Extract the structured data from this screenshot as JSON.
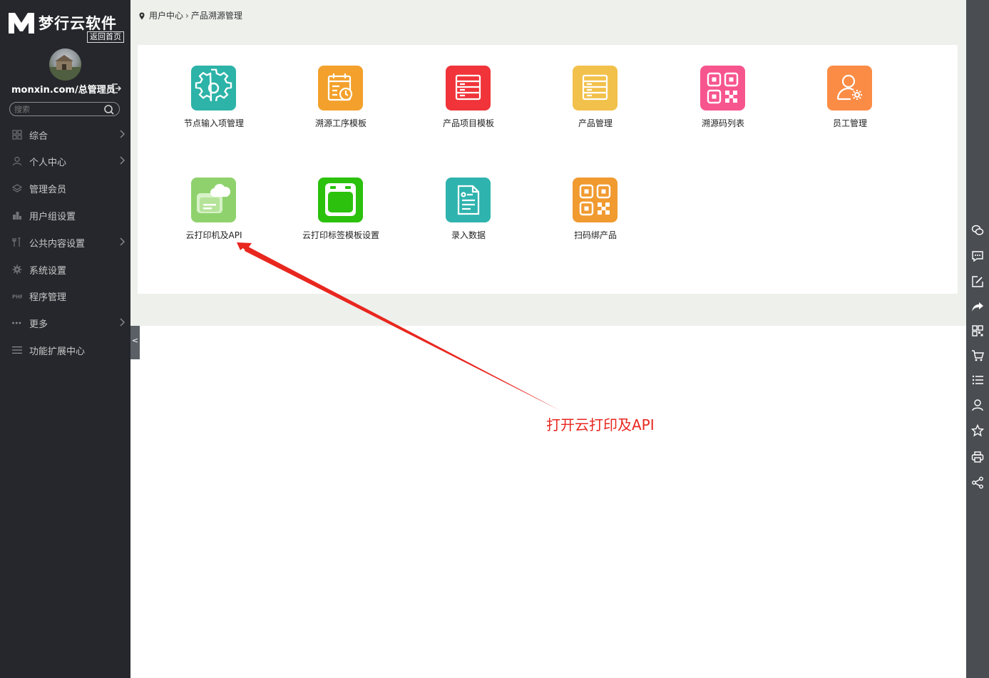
{
  "brand": {
    "name": "梦行云软件",
    "home_link": "返回首页"
  },
  "user": {
    "label": "monxin.com/总管理员"
  },
  "search": {
    "placeholder": "搜索"
  },
  "sidebar": {
    "items": [
      {
        "label": "综合",
        "icon": "grid-icon",
        "has_arrow": true
      },
      {
        "label": "个人中心",
        "icon": "user-icon",
        "has_arrow": true
      },
      {
        "label": "管理会员",
        "icon": "layers-icon",
        "has_arrow": false
      },
      {
        "label": "用户组设置",
        "icon": "buildings-icon",
        "has_arrow": false
      },
      {
        "label": "公共内容设置",
        "icon": "tools-icon",
        "has_arrow": true
      },
      {
        "label": "系统设置",
        "icon": "gear-icon",
        "has_arrow": false
      },
      {
        "label": "程序管理",
        "icon": "php-icon",
        "has_arrow": false
      },
      {
        "label": "更多",
        "icon": "dots-icon",
        "has_arrow": true
      },
      {
        "label": "功能扩展中心",
        "icon": "menu-icon",
        "has_arrow": false
      }
    ],
    "collapse_glyph": "<"
  },
  "breadcrumb": {
    "items": [
      "用户中心",
      "产品溯源管理"
    ],
    "separator": "›"
  },
  "tiles": [
    {
      "label": "节点输入项管理",
      "icon": "gear-icon",
      "color": "#2db3a8"
    },
    {
      "label": "溯源工序模板",
      "icon": "calendar-clock-icon",
      "color": "#f3a12c"
    },
    {
      "label": "产品项目模板",
      "icon": "list-icon",
      "color": "#f0343a"
    },
    {
      "label": "产品管理",
      "icon": "list-icon",
      "color": "#f2c14b"
    },
    {
      "label": "溯源码列表",
      "icon": "qrcode-icon",
      "color": "#f7558e"
    },
    {
      "label": "员工管理",
      "icon": "user-gear-icon",
      "color": "#fb8c45"
    },
    {
      "label": "云打印机及API",
      "icon": "cloud-printer-icon",
      "color": "#8fd26d"
    },
    {
      "label": "云打印标签模板设置",
      "icon": "label-template-icon",
      "color": "#2bc10c"
    },
    {
      "label": "录入数据",
      "icon": "document-icon",
      "color": "#2fb3ae"
    },
    {
      "label": "扫码绑产品",
      "icon": "qrcode-icon",
      "color": "#f09a30"
    }
  ],
  "annotation": {
    "text": "打开云打印及API",
    "color": "#e8271f"
  },
  "right_toolbar": {
    "icons": [
      "wechat-icon",
      "message-icon",
      "edit-icon",
      "share-arrow-icon",
      "qrcode-icon",
      "cart-icon",
      "list-icon",
      "user-icon",
      "star-icon",
      "print-icon",
      "share-icon"
    ]
  }
}
